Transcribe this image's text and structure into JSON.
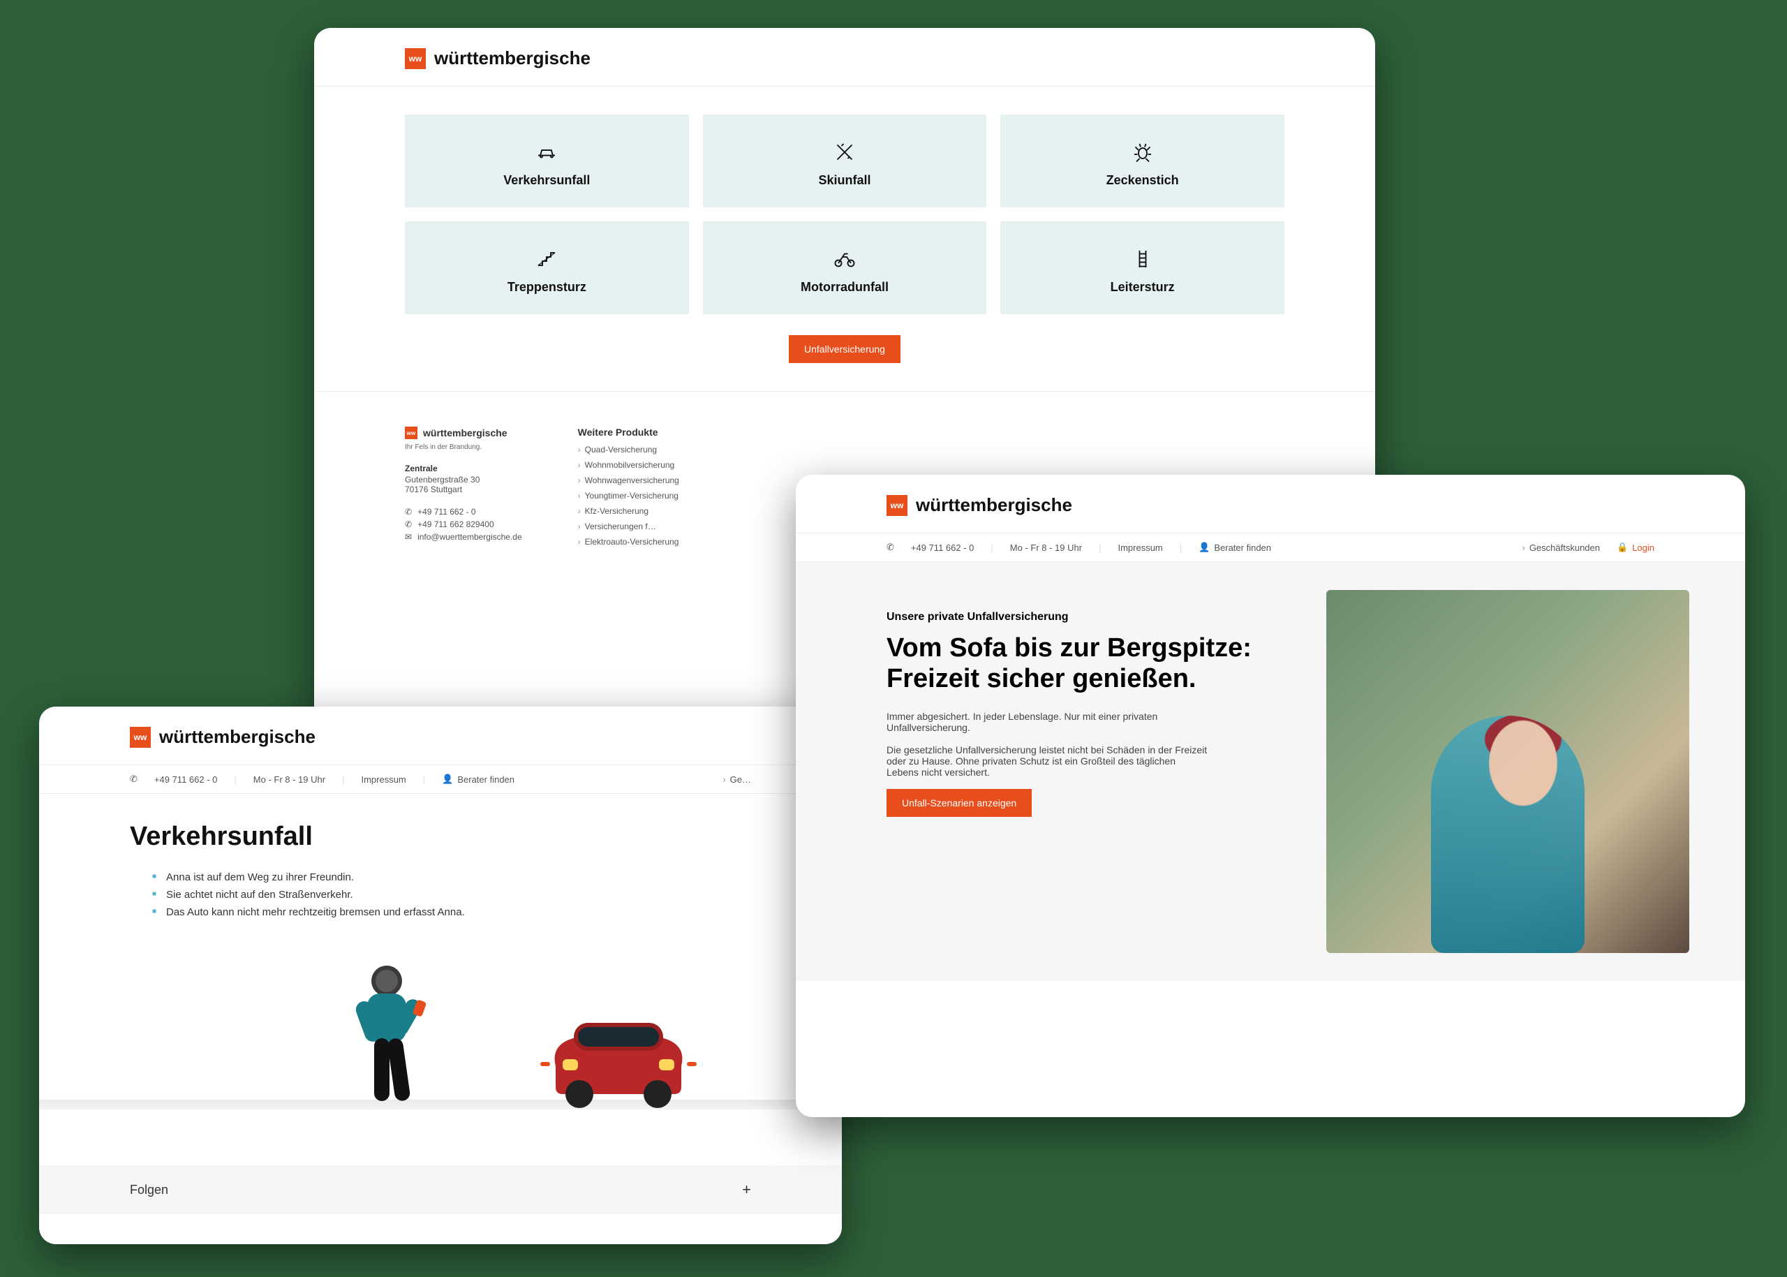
{
  "brand": {
    "name": "württembergische",
    "logo_letters": "ww",
    "tagline": "Ihr Fels in der Brandung."
  },
  "colors": {
    "accent": "#e84e1c",
    "tile_bg": "#e6f1f1"
  },
  "window1": {
    "tiles": [
      {
        "label": "Verkehrsunfall",
        "icon": "car-icon"
      },
      {
        "label": "Skiunfall",
        "icon": "ski-icon"
      },
      {
        "label": "Zeckenstich",
        "icon": "tick-icon"
      },
      {
        "label": "Treppensturz",
        "icon": "stairs-icon"
      },
      {
        "label": "Motorradunfall",
        "icon": "motorcycle-icon"
      },
      {
        "label": "Leitersturz",
        "icon": "ladder-icon"
      }
    ],
    "cta_label": "Unfallversicherung",
    "footer": {
      "address": {
        "label": "Zentrale",
        "street": "Gutenbergstraße 30",
        "city": "70176 Stuttgart"
      },
      "contact": {
        "phone1": "+49 711 662 - 0",
        "phone2": "+49 711 662 829400",
        "email": "info@wuerttembergische.de"
      },
      "products_heading": "Weitere Produkte",
      "products": [
        "Quad-Versicherung",
        "Wohnmobilversicherung",
        "Wohnwagenversicherung",
        "Youngtimer-Versicherung",
        "Kfz-Versicherung",
        "Versicherungen f…",
        "Elektroauto-Versicherung"
      ]
    }
  },
  "window2": {
    "topbar": {
      "phone": "+49 711 662 - 0",
      "hours": "Mo - Fr 8 - 19 Uhr",
      "impressum": "Impressum",
      "berater": "Berater finden",
      "geschaeft_short": "Ge…"
    },
    "title": "Verkehrsunfall",
    "bullets": [
      "Anna ist auf dem Weg zu ihrer Freundin.",
      "Sie achtet nicht auf den Straßenverkehr.",
      "Das Auto kann nicht mehr rechtzeitig bremsen und erfasst Anna."
    ],
    "expand_label": "Folgen"
  },
  "window3": {
    "topbar": {
      "phone": "+49 711 662 - 0",
      "hours": "Mo - Fr 8 - 19 Uhr",
      "impressum": "Impressum",
      "berater": "Berater finden",
      "geschaeft": "Geschäftskunden",
      "login": "Login"
    },
    "kicker": "Unsere private Unfallversicherung",
    "headline1": "Vom Sofa bis zur Bergspitze:",
    "headline2": "Freizeit sicher genießen.",
    "para1": "Immer abgesichert. In jeder Lebenslage. Nur mit einer privaten Unfallversicherung.",
    "para2": "Die gesetzliche Unfallversicherung leistet nicht bei Schäden in der Freizeit oder zu Hause. Ohne privaten Schutz ist ein Großteil des täglichen Lebens nicht versichert.",
    "cta_label": "Unfall-Szenarien anzeigen"
  }
}
